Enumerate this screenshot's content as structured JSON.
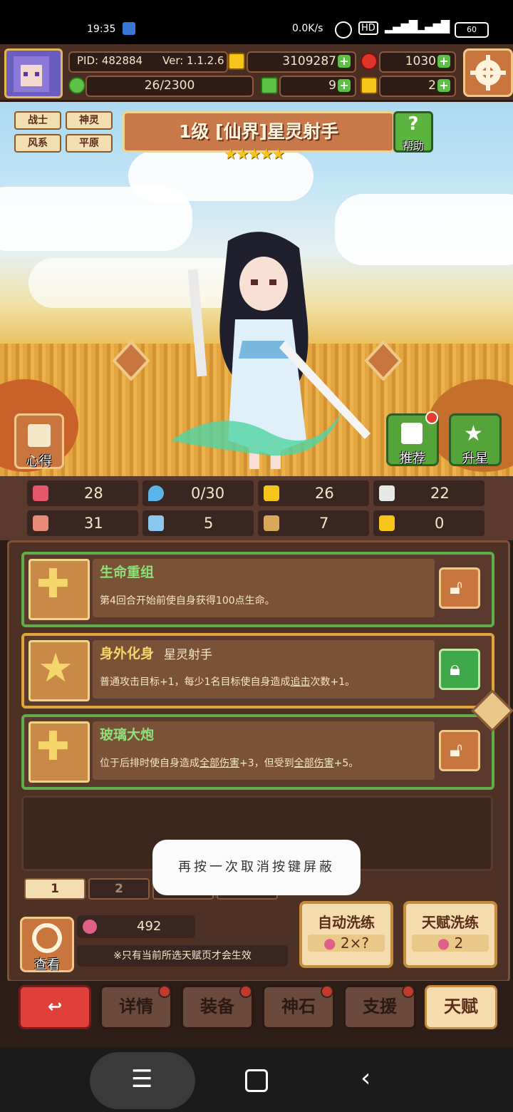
{
  "status_bar": {
    "time": "19:35",
    "network_speed": "0.0K/s",
    "hd_label": "HD",
    "battery": "60"
  },
  "hud": {
    "pid": "PID: 482884",
    "version": "Ver: 1.1.2.6",
    "gold": "3109287",
    "gems": "1030",
    "stamina": "26/2300",
    "clover": "9",
    "key": "2"
  },
  "hero": {
    "tags": [
      "战士",
      "神灵",
      "风系",
      "平原"
    ],
    "title": "1级  [仙界]星灵射手",
    "stars": 5,
    "help_label": "帮助",
    "left_button_label": "心得",
    "recommend_label": "推荐",
    "upgrade_star_label": "升星"
  },
  "stats": [
    {
      "icon": "heart-icon",
      "value": "28"
    },
    {
      "icon": "mana-drop-icon",
      "value": "0/30"
    },
    {
      "icon": "shield-icon",
      "value": "26"
    },
    {
      "icon": "wing-icon",
      "value": "22"
    },
    {
      "icon": "fist-icon",
      "value": "31"
    },
    {
      "icon": "book-icon",
      "value": "5"
    },
    {
      "icon": "scroll-icon",
      "value": "7"
    },
    {
      "icon": "crown-icon",
      "value": "0"
    }
  ],
  "talents": [
    {
      "name": "生命重组",
      "sub": "",
      "desc_parts": [
        "第4回合开始前使自身获得100点生命。"
      ],
      "locked_state": "unlocked"
    },
    {
      "name": "身外化身",
      "sub": "星灵射手",
      "desc_a": "普通攻击目标+1，每少1名目标使自身造成",
      "desc_u1": "追击",
      "desc_b": "次数+1。",
      "locked_state": "locked"
    },
    {
      "name": "玻璃大炮",
      "sub": "",
      "desc_a": "位于后排时使自身造成",
      "desc_u1": "全部伤害",
      "desc_b": "+3，但受到",
      "desc_u2": "全部伤害",
      "desc_c": "+5。",
      "locked_state": "unlocked"
    }
  ],
  "pages": [
    "1",
    "2"
  ],
  "bottom": {
    "view_label": "查看",
    "essence_count": "492",
    "note": "※只有当前所选天赋页才会生效",
    "auto_wash_label": "自动洗练",
    "auto_wash_cost": "2×?",
    "talent_wash_label": "天赋洗练",
    "talent_wash_cost": "2"
  },
  "nav": {
    "details": "详情",
    "equipment": "装备",
    "stone": "神石",
    "support": "支援",
    "talent": "天赋"
  },
  "toast": "再按一次取消按键屏蔽",
  "colors": {
    "talent_green_border": "#5fae4a",
    "talent_gold_border": "#e0a53a",
    "accent_red": "#e53c2e"
  }
}
